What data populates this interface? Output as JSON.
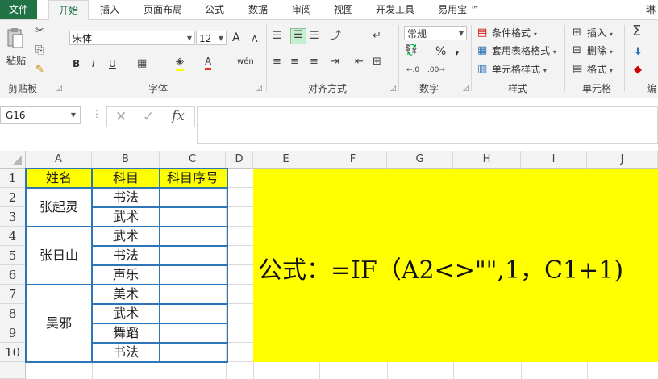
{
  "tabs": [
    "文件",
    "开始",
    "插入",
    "页面布局",
    "公式",
    "数据",
    "审阅",
    "视图",
    "开发工具",
    "易用宝 ™"
  ],
  "account_fragment": "琳",
  "ribbon": {
    "clipboard": {
      "paste_label": "粘贴",
      "group_label": "剪贴板"
    },
    "font": {
      "font_name": "宋体",
      "font_size": "12",
      "bold": "B",
      "italic": "I",
      "underline": "U",
      "grow": "A",
      "shrink": "A",
      "font_color": "A",
      "phonetic": "wén",
      "group_label": "字体"
    },
    "alignment": {
      "group_label": "对齐方式"
    },
    "number": {
      "format": "常规",
      "percent": "%",
      "comma": ",",
      "group_label": "数字"
    },
    "styles": {
      "conditional": "条件格式",
      "table": "套用表格格式",
      "cell_styles": "单元格样式",
      "group_label": "样式"
    },
    "cells": {
      "insert": "插入",
      "delete": "删除",
      "format": "格式",
      "group_label": "单元格"
    },
    "editing": {
      "group_label": "编"
    }
  },
  "formula_bar": {
    "name_box": "G16",
    "cancel": "✕",
    "enter": "✓",
    "fx": "fx",
    "content": ""
  },
  "columns": [
    "A",
    "B",
    "C",
    "D",
    "E",
    "F",
    "G",
    "H",
    "I",
    "J"
  ],
  "rows": [
    "1",
    "2",
    "3",
    "4",
    "5",
    "6",
    "7",
    "8",
    "9",
    "10"
  ],
  "table": {
    "header": [
      "姓名",
      "科目",
      "科目序号"
    ],
    "names": [
      "张起灵",
      "张日山",
      "吴邪"
    ],
    "subjects": [
      "书法",
      "武术",
      "武术",
      "书法",
      "声乐",
      "美术",
      "武术",
      "舞蹈",
      "书法"
    ]
  },
  "formula_note": "公式：=IF（A2<>\"\",1，C1+1)",
  "colors": {
    "accent": "#217346",
    "highlight": "#ffff00",
    "table_border": "#2e75b6"
  }
}
